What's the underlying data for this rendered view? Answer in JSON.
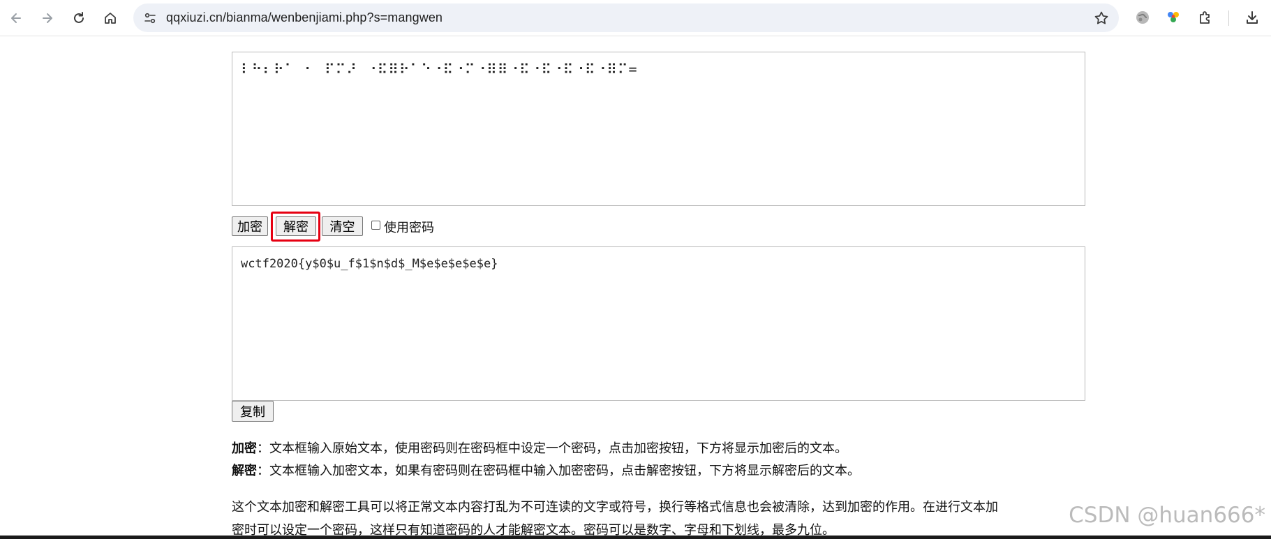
{
  "browser": {
    "url": "qqxiuzi.cn/bianma/wenbenjiami.php?s=mangwen",
    "nav_icons": [
      "back-icon",
      "forward-icon",
      "reload-icon",
      "home-icon"
    ],
    "right_icons": [
      "bookmark-star-icon",
      "extension-globe-icon",
      "extension-colorful-icon",
      "extensions-puzzle-icon",
      "download-icon"
    ]
  },
  "input_box": {
    "value": "⠇⠓⠆⠗⠁ ⠂ ⠏⠍⠜ ⠐⠯⠿⠗⠁⠑⠐⠯⠐⠍⠐⠿⠿⠐⠯⠐⠯⠐⠯⠐⠯⠐⠿⠍="
  },
  "buttons": {
    "encrypt": "加密",
    "decrypt": "解密",
    "clear": "清空",
    "use_password": "使用密码",
    "copy": "复制"
  },
  "output_box": {
    "value": "wctf2020{y$0$u_f$1$n$d$_M$e$e$e$e$e}"
  },
  "help": {
    "encrypt_title": "加密",
    "encrypt_text": "：文本框输入原始文本，使用密码则在密码框中设定一个密码，点击加密按钮，下方将显示加密后的文本。",
    "decrypt_title": "解密",
    "decrypt_text": "：文本框输入加密文本，如果有密码则在密码框中输入加密密码，点击解密按钮，下方将显示解密后的文本。",
    "desc_line1": "这个文本加密和解密工具可以将正常文本内容打乱为不可连读的文字或符号，换行等格式信息也会被清除，达到加密的作用。在进行文本加",
    "desc_line2": "密时可以设定一个密码，这样只有知道密码的人才能解密文本。密码可以是数字、字母和下划线，最多九位。"
  },
  "watermark": "CSDN @huan666*",
  "colors": {
    "highlight_border": "#e60012",
    "omnibox_bg": "#eef1f7"
  }
}
